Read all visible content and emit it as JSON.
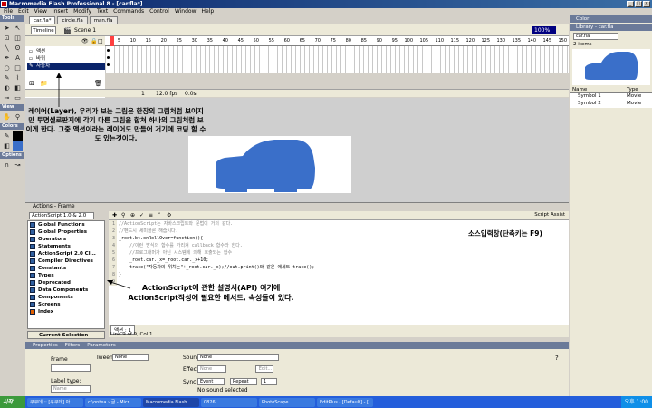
{
  "window": {
    "title": "Macromedia Flash Professional 8 - [car.fla*]"
  },
  "menu": [
    "File",
    "Edit",
    "View",
    "Insert",
    "Modify",
    "Text",
    "Commands",
    "Control",
    "Window",
    "Help"
  ],
  "tools_panel": {
    "title": "Tools",
    "view_label": "View",
    "colors_label": "Colors",
    "options_label": "Options"
  },
  "doc_tabs": [
    "car.fla*",
    "circle.fla",
    "man.fla"
  ],
  "timeline": {
    "button": "Timeline",
    "scene": "Scene 1",
    "zoom": "100%",
    "frame_numbers": [
      "5",
      "10",
      "15",
      "20",
      "25",
      "30",
      "35",
      "40",
      "45",
      "50",
      "55",
      "60",
      "65",
      "70",
      "75",
      "80",
      "85",
      "90",
      "95",
      "100",
      "105",
      "110",
      "115",
      "120",
      "125",
      "130",
      "135",
      "140",
      "145",
      "150"
    ],
    "layers": [
      "액션",
      "바퀴",
      "자동차"
    ],
    "status": {
      "frame": "1",
      "fps": "12.0 fps",
      "time": "0.0s"
    }
  },
  "annotations": {
    "layer_note": "레이어(Layer), 우리가 보는 그림은 한장의 그림처럼 보이지만 투명셀로판지에 각기 다른 그림을 합쳐 하나의 그림처럼 보이게 한다. 그중 액션이라는 레이어도 만들어 거기에 코딩 할 수 도 있는것이다.",
    "api_note": "ActionScript에 관한 설명서(API) 여기에 ActionScript작성에 필요한 메서드, 속성들이 있다.",
    "input_note": "소스입력창(단축키는 F9)"
  },
  "actions": {
    "header": "Actions - Frame",
    "version_select": "ActionScript 1.0 & 2.0",
    "script_assist": "Script Assist",
    "categories": [
      "Global Functions",
      "Global Properties",
      "Operators",
      "Statements",
      "ActionScript 2.0 Cl...",
      "Compiler Directives",
      "Constants",
      "Types",
      "Deprecated",
      "Data Components",
      "Components",
      "Screens",
      "Index"
    ],
    "current_selection": "Current Selection",
    "tab_label": "액션 : 1",
    "status_line": "Line 9 of 9, Col 1",
    "code_lines": [
      {
        "n": "1",
        "text": "//ActionScript는 자바스크립트와 문법이 거의 같다."
      },
      {
        "n": "2",
        "text": "//펜드시 세미콜론 해줍시다."
      },
      {
        "n": "3",
        "text": "_root.bt.onRollOver=function(){"
      },
      {
        "n": "4",
        "text": "    //이런 방식의 함수를 가리켜 callback 함수라 한다."
      },
      {
        "n": "5",
        "text": "    //프로그래머가 아닌 시스템에 의해 호출되는 함수"
      },
      {
        "n": "6",
        "text": "    _root.car._x=_root.car._x+10;"
      },
      {
        "n": "7",
        "text": "    trace(\"자동차의 위치는\"+_root.car._x);//out.print()와 같은 에세트 trace();"
      },
      {
        "n": "8",
        "text": "}"
      },
      {
        "n": "9",
        "text": ""
      }
    ]
  },
  "properties": {
    "tabs": [
      "Properties",
      "Filters",
      "Parameters"
    ],
    "frame_label": "Frame",
    "label_type": "Label type:",
    "label_type_value": "Name",
    "tween_label": "Tween:",
    "tween_value": "None",
    "sound_label": "Sound:",
    "sound_value": "None",
    "effect_label": "Effect:",
    "effect_value": "None",
    "edit_btn": "Edit...",
    "sync_label": "Sync:",
    "sync_value": "Event",
    "repeat_value": "Repeat",
    "repeat_count": "1",
    "no_sound": "No sound selected"
  },
  "right_panel": {
    "color_title": "Color",
    "library_title": "Library - car.fla",
    "library_select": "car.fla",
    "items_count": "2 items",
    "col_name": "Name",
    "col_type": "Type",
    "symbols": [
      {
        "name": "Symbol 1",
        "type": "Movie"
      },
      {
        "name": "Symbol 2",
        "type": "Movie"
      }
    ]
  },
  "taskbar": {
    "start": "시작",
    "tasks": [
      "쿠쿠데 :: [쿠쿠데] 아...",
      "c:\\ontea › 글 - Micr...",
      "Macromedia Flash...",
      "0826",
      "PhotoScape",
      "EditPlus - [Default] - [...]"
    ],
    "clock": "오후 1:00"
  },
  "colors": {
    "car_blue": "#3a6fc9",
    "title_blue": "#0a246a",
    "taskbar": "#245edb"
  }
}
